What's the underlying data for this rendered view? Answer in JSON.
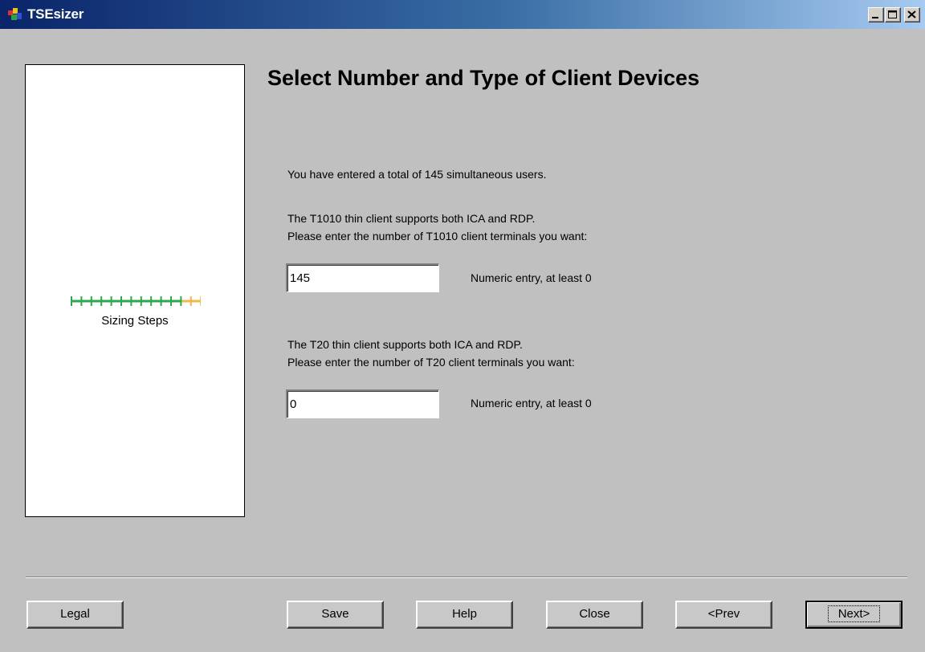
{
  "window": {
    "title": "TSEsizer"
  },
  "left_panel": {
    "steps_label": "Sizing Steps",
    "steps_total": 13,
    "steps_completed": 11
  },
  "main": {
    "heading": "Select Number and Type of Client Devices",
    "total_users_text": "You have entered a total of 145 simultaneous users.",
    "t1010": {
      "desc_line1": "The T1010 thin client supports both ICA and RDP.",
      "desc_line2": "Please enter the number of T1010 client terminals you want:",
      "value": "145",
      "hint": "Numeric entry, at least 0"
    },
    "t20": {
      "desc_line1": "The T20 thin client supports both ICA and RDP.",
      "desc_line2": "Please enter the number of T20 client terminals you want:",
      "value": "0",
      "hint": "Numeric entry, at least 0"
    }
  },
  "buttons": {
    "legal": "Legal",
    "save": "Save",
    "help": "Help",
    "close": "Close",
    "prev": "<Prev",
    "next": "Next>"
  },
  "colors": {
    "steps_done": "#2aa84a",
    "steps_remaining": "#f0b848"
  }
}
